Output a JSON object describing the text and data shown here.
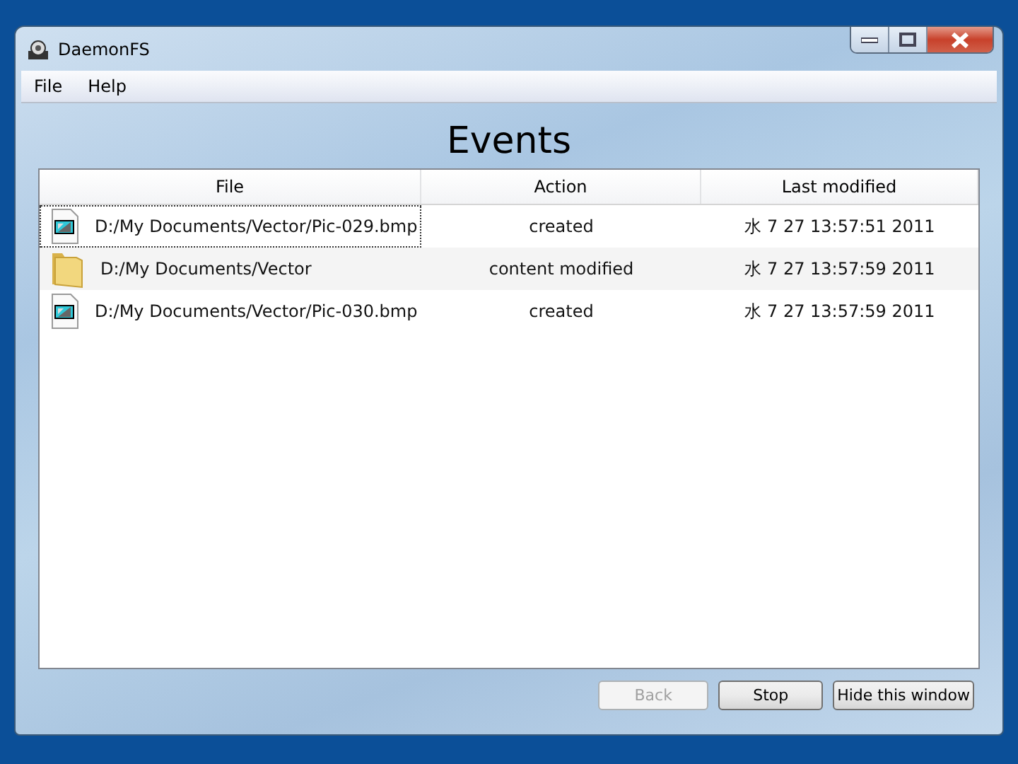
{
  "window": {
    "title": "DaemonFS"
  },
  "menu": [
    "File",
    "Help"
  ],
  "heading": "Events",
  "table": {
    "columns": [
      "File",
      "Action",
      "Last modified"
    ],
    "rows": [
      {
        "kind": "image",
        "file": "D:/My Documents/Vector/Pic-029.bmp",
        "action": "created",
        "modified": "水 7 27 13:57:51 2011",
        "focused": true
      },
      {
        "kind": "folder",
        "file": "D:/My Documents/Vector",
        "action": "content modified",
        "modified": "水 7 27 13:57:59 2011",
        "focused": false
      },
      {
        "kind": "image",
        "file": "D:/My Documents/Vector/Pic-030.bmp",
        "action": "created",
        "modified": "水 7 27 13:57:59 2011",
        "focused": false
      }
    ]
  },
  "buttons": [
    {
      "label": "Back",
      "disabled": true
    },
    {
      "label": "Stop",
      "disabled": false
    },
    {
      "label": "Hide this window",
      "disabled": false
    }
  ]
}
